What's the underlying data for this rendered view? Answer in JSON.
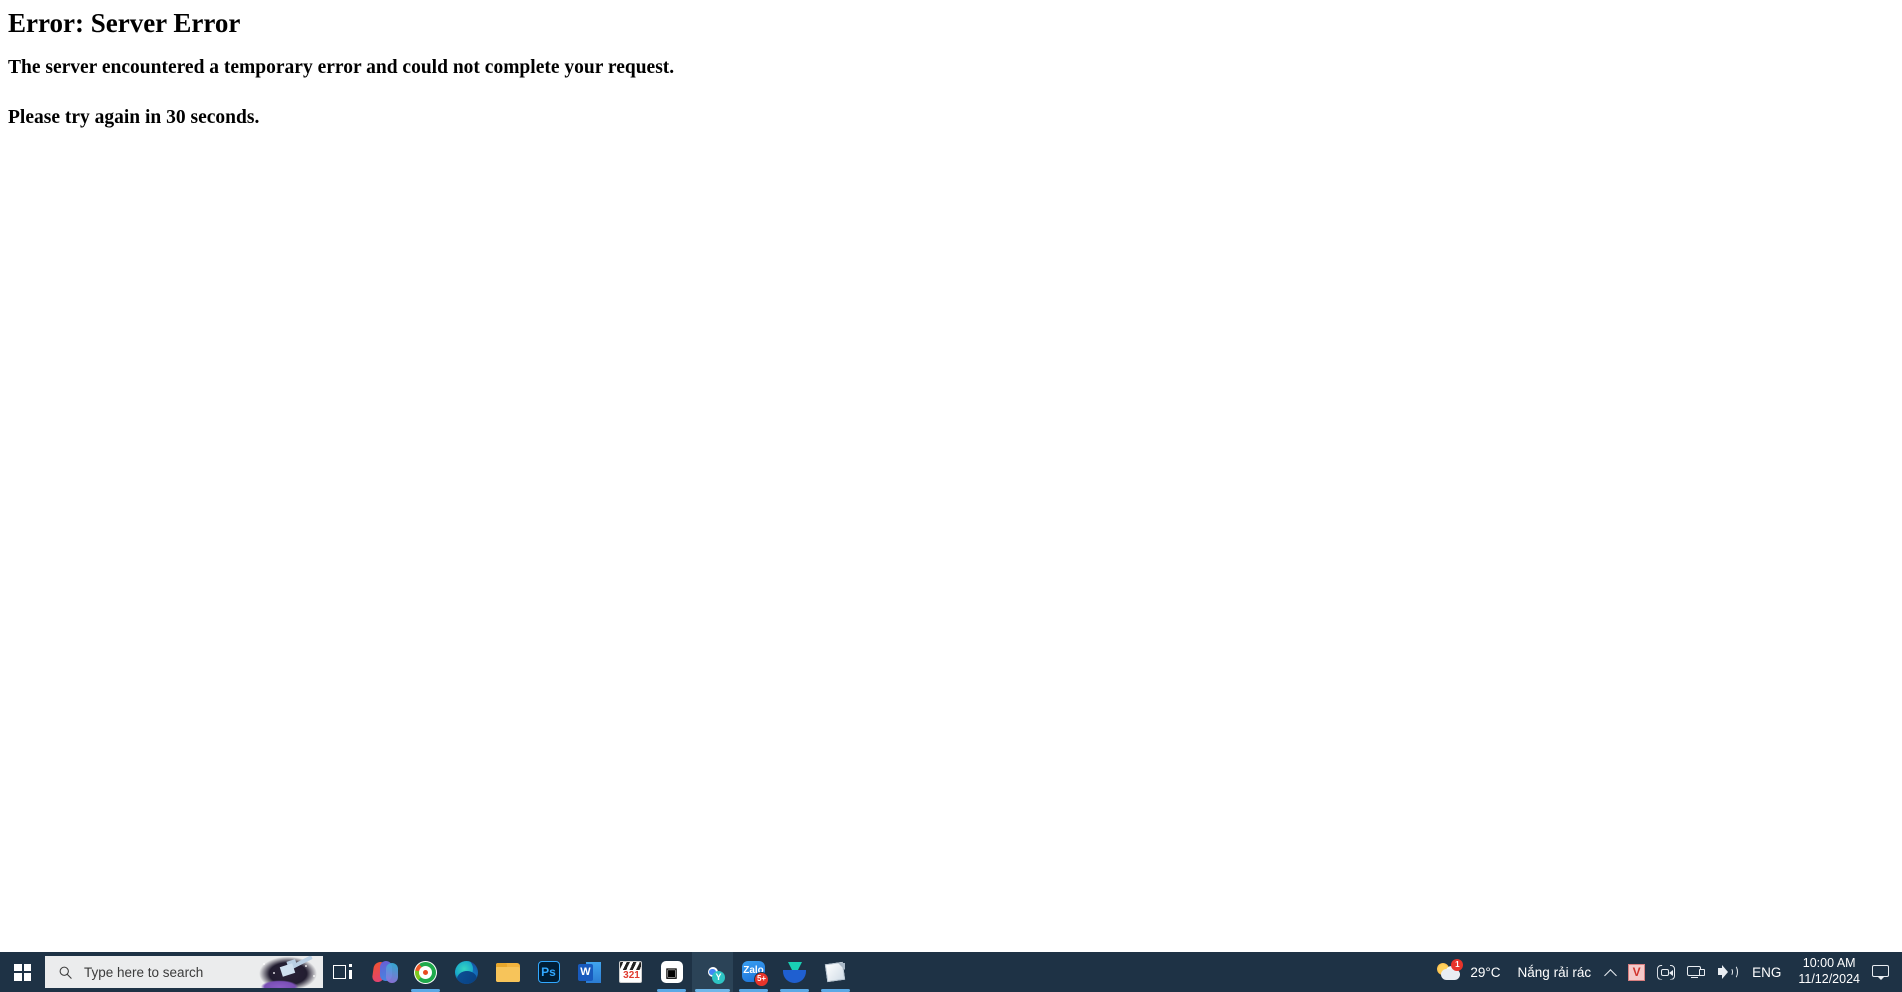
{
  "page": {
    "error_title": "Error: Server Error",
    "error_line1": "The server encountered a temporary error and could not complete your request.",
    "error_line2": "Please try again in 30 seconds.",
    "background_color": "#ffffff",
    "text_color": "#000000"
  },
  "taskbar": {
    "background_color": "#1e3245",
    "start_label": "Start",
    "search": {
      "placeholder": "Type here to search",
      "value": "",
      "background_color": "#ebeced"
    },
    "task_view_label": "Task View",
    "apps": [
      {
        "name": "copilot",
        "label": "Copilot",
        "running": false,
        "badge": ""
      },
      {
        "name": "green-circle-app",
        "label": "App",
        "running": true,
        "badge": ""
      },
      {
        "name": "microsoft-edge",
        "label": "Microsoft Edge",
        "running": false,
        "badge": ""
      },
      {
        "name": "file-explorer",
        "label": "File Explorer",
        "running": false,
        "badge": ""
      },
      {
        "name": "adobe-photoshop",
        "label": "Adobe Photoshop",
        "running": false,
        "badge": ""
      },
      {
        "name": "microsoft-word",
        "label": "Microsoft Word",
        "running": false,
        "badge": ""
      },
      {
        "name": "clapperboard-321",
        "label": "321",
        "running": false,
        "badge": ""
      },
      {
        "name": "capcut",
        "label": "CapCut",
        "running": true,
        "badge": ""
      },
      {
        "name": "google-chrome",
        "label": "Google Chrome",
        "running": true,
        "active": true,
        "badge": "Y"
      },
      {
        "name": "zalo",
        "label": "Zalo",
        "running": true,
        "badge": "5+"
      },
      {
        "name": "download-manager",
        "label": "Download Manager",
        "running": true,
        "badge": ""
      },
      {
        "name": "sticky-notes",
        "label": "Notes",
        "running": true,
        "badge": ""
      }
    ]
  },
  "tray": {
    "weather": {
      "temperature": "29°C",
      "condition": "Nắng rải rác",
      "badge_count": "1"
    },
    "show_hidden_icons_label": "Show hidden icons",
    "unikey_label": "V",
    "camera_label": "Camera",
    "network_label": "Network",
    "volume_label": "Volume",
    "language": "ENG",
    "time": "10:00 AM",
    "date": "11/12/2024",
    "notifications_label": "Notifications"
  }
}
